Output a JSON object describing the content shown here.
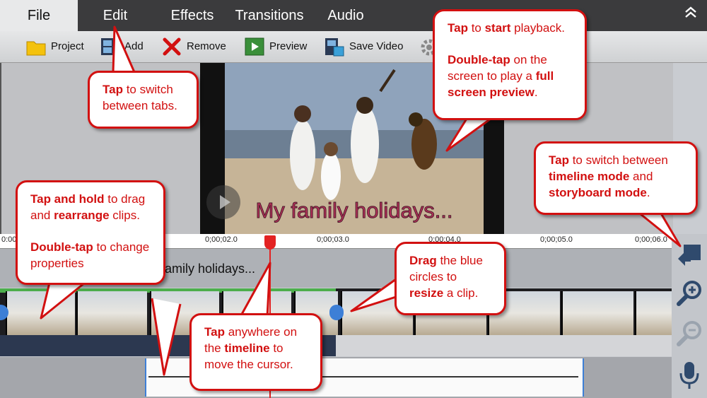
{
  "menu": {
    "tabs": [
      "File",
      "Edit",
      "Effects",
      "Transitions",
      "Audio"
    ],
    "collapse_icon": "chevron-up-icon"
  },
  "toolbar": {
    "project_label": "Project",
    "add_label": "Add",
    "remove_label": "Remove",
    "preview_label": "Preview",
    "save_label": "Save Video"
  },
  "video": {
    "caption": "My family holidays..."
  },
  "ruler": {
    "ticks": [
      "0:00",
      "0;00;02.0",
      "0;00;03.0",
      "0;00;04.0",
      "0;00;05.0",
      "0;00;06.0"
    ]
  },
  "tracks": {
    "title_text": "family holidays..."
  },
  "callouts": {
    "tabs": {
      "bold1": "Tap",
      "text1": " to switch between tabs."
    },
    "playback": {
      "bold1": "Tap",
      "text1": " to ",
      "bold2": "start",
      "text2": " playback.",
      "bold3": "Double-tap",
      "text3": " on the screen to play a ",
      "bold4": "full screen preview",
      "text4": "."
    },
    "mode": {
      "bold1": "Tap",
      "text1": " to switch between ",
      "bold2": "timeline mode",
      "text2": " and ",
      "bold3": "storyboard mode",
      "text3": "."
    },
    "rearrange": {
      "bold1": "Tap and hold",
      "text1": " to drag and ",
      "bold2": "rearrange",
      "text2": " clips.",
      "bold3": "Double-tap",
      "text3": " to change properties"
    },
    "resize": {
      "bold1": "Drag",
      "text1": " the blue circles to ",
      "bold2": "resize",
      "text2": " a clip."
    },
    "cursor": {
      "bold1": "Tap",
      "text1": " anywhere on the ",
      "bold2": "timeline",
      "text2": " to move the cursor."
    }
  },
  "colors": {
    "callout_red": "#d21010",
    "menu_bg": "#3b3b3d",
    "cursor_red": "#e32222",
    "clip_handle_blue": "#3d7fd6"
  }
}
